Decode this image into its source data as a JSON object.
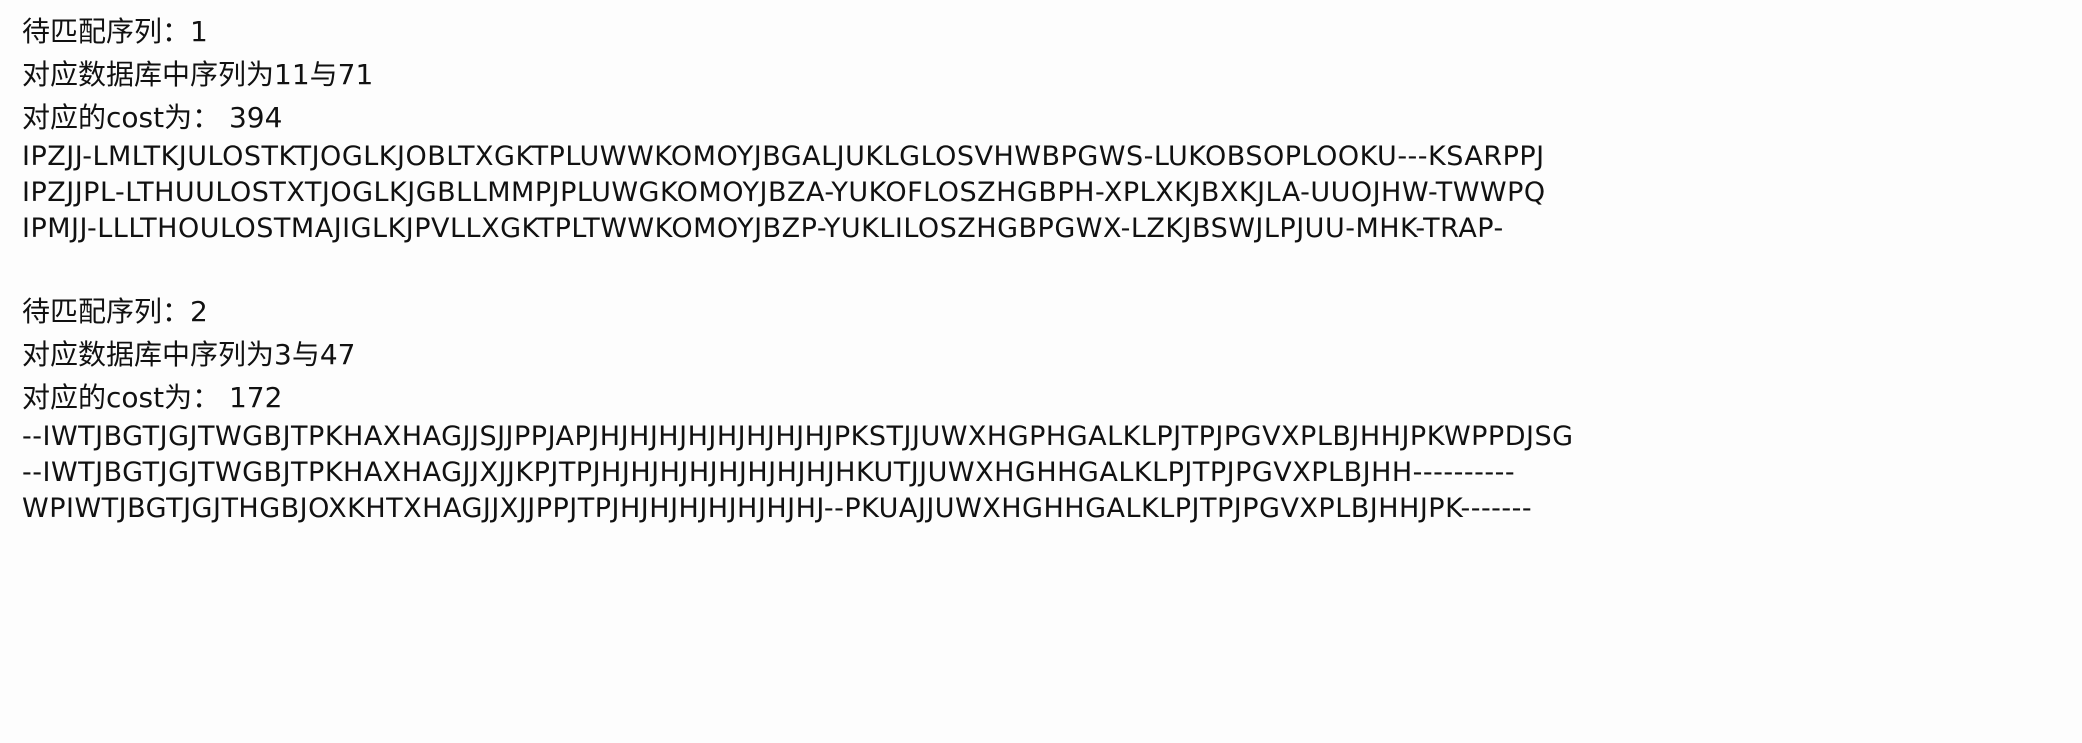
{
  "output": {
    "blocks": [
      {
        "header": "待匹配序列：1",
        "db_line": "对应数据库中序列为11与71",
        "cost_line": "对应的cost为： 394",
        "sequences": [
          "IPZJJ-LMLTKJULOSTKTJOGLKJOBLTXGKTPLUWWKOMOYJBGALJUKLGLOSVHWBPGWS-LUKOBSOPLOOKU---KSARPPJ",
          "IPZJJPL-LTHUULOSTXTJOGLKJGBLLMMPJPLUWGKOMOYJBZA-YUKOFLOSZHGBPH-XPLXKJBXKJLA-UUOJHW-TWWPQ",
          "IPMJJ-LLLTHOULOSTMAJIGLKJPVLLXGKTPLTWWKOMOYJBZP-YUKLILOSZHGBPGWX-LZKJBSWJLPJUU-MHK-TRAP-"
        ]
      },
      {
        "header": "待匹配序列：2",
        "db_line": "对应数据库中序列为3与47",
        "cost_line": "对应的cost为： 172",
        "sequences": [
          "--IWTJBGTJGJTWGBJTPKHAXHAGJJSJJPPJAPJHJHJHJHJHJHJHJHJPKSTJJUWXHGPHGALKLPJTPJPGVXPLBJHHJPKWPPDJSG",
          "--IWTJBGTJGJTWGBJTPKHAXHAGJJXJJKPJTPJHJHJHJHJHJHJHJHJHKUTJJUWXHGHHGALKLPJTPJPGVXPLBJHH----------",
          "WPIWTJBGTJGJTHGBJOXKHTXHAGJJXJJPPJTPJHJHJHJHJHJHJHJ--PKUAJJUWXHGHHGALKLPJTPJPGVXPLBJHHJPK-------"
        ]
      }
    ]
  }
}
